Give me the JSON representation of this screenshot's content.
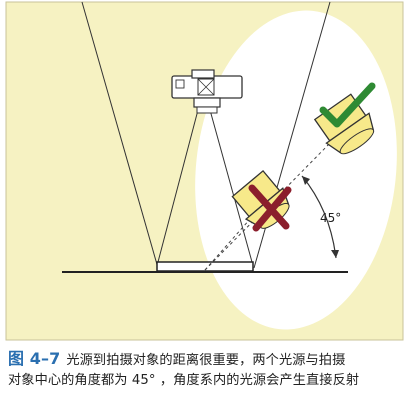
{
  "figure": {
    "angle_label": "45°",
    "colors": {
      "background": "#f6f2c2",
      "frame": "#c8c39a",
      "ellipse": "#ffffff",
      "lamp": "#f7e98a",
      "lamp_stroke": "#333333",
      "check": "#2e8a33",
      "cross": "#8b1e2c"
    },
    "icons": [
      "camera-icon",
      "lamp-icon",
      "checkmark-icon",
      "cross-icon",
      "angle-arrow-icon"
    ]
  },
  "caption": {
    "label": "图 4–7",
    "line1": "光源到拍摄对象的距离很重要，两个光源与拍摄",
    "line2": "对象中心的角度都为 45° ，角度系内的光源会产生直接反射"
  }
}
